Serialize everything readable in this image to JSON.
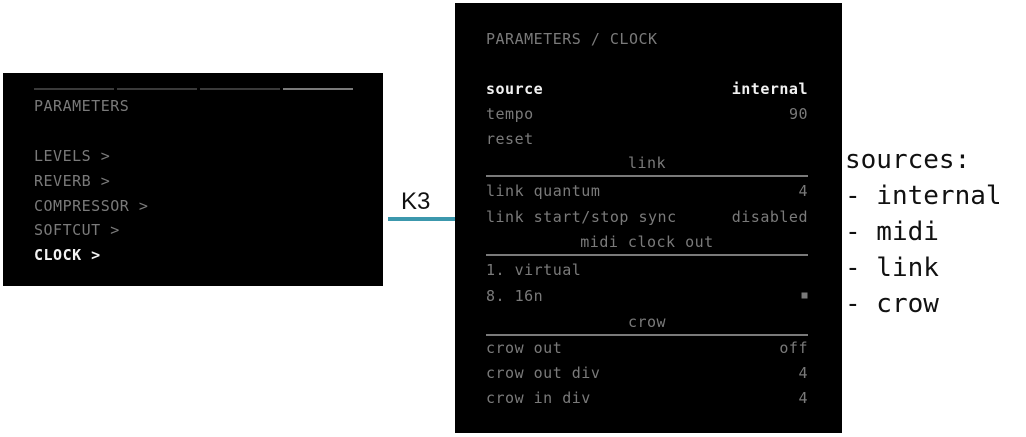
{
  "left_screen": {
    "title": "PARAMETERS",
    "menu": [
      {
        "label": "LEVELS >",
        "selected": false
      },
      {
        "label": "REVERB >",
        "selected": false
      },
      {
        "label": "COMPRESSOR >",
        "selected": false
      },
      {
        "label": "SOFTCUT >",
        "selected": false
      },
      {
        "label": "CLOCK >",
        "selected": true
      }
    ]
  },
  "key_label": "K3",
  "right_screen": {
    "title": "PARAMETERS / CLOCK",
    "rows": {
      "source": {
        "label": "source",
        "value": "internal"
      },
      "tempo": {
        "label": "tempo",
        "value": "90"
      },
      "reset": {
        "label": "reset"
      },
      "link_header": "link",
      "link_quantum": {
        "label": "link quantum",
        "value": "4"
      },
      "link_sync": {
        "label": "link start/stop sync",
        "value": "disabled"
      },
      "midi_header": "midi clock out",
      "virtual": {
        "label": "1. virtual"
      },
      "sixteen": {
        "label": "8. 16n",
        "value": "■"
      },
      "crow_header": "crow",
      "crow_out": {
        "label": "crow out",
        "value": "off"
      },
      "crow_out_div": {
        "label": "crow out div",
        "value": "4"
      },
      "crow_in_div": {
        "label": "crow in div",
        "value": "4"
      }
    }
  },
  "annotation": {
    "title": "sources:",
    "items": [
      "- internal",
      "- midi",
      "- link",
      "- crow"
    ]
  },
  "colors": {
    "screen_bg": "#000000",
    "text_dim": "#7a7a7a",
    "text_bright": "#f2f2f2",
    "accent_line": "#3c98ad"
  }
}
